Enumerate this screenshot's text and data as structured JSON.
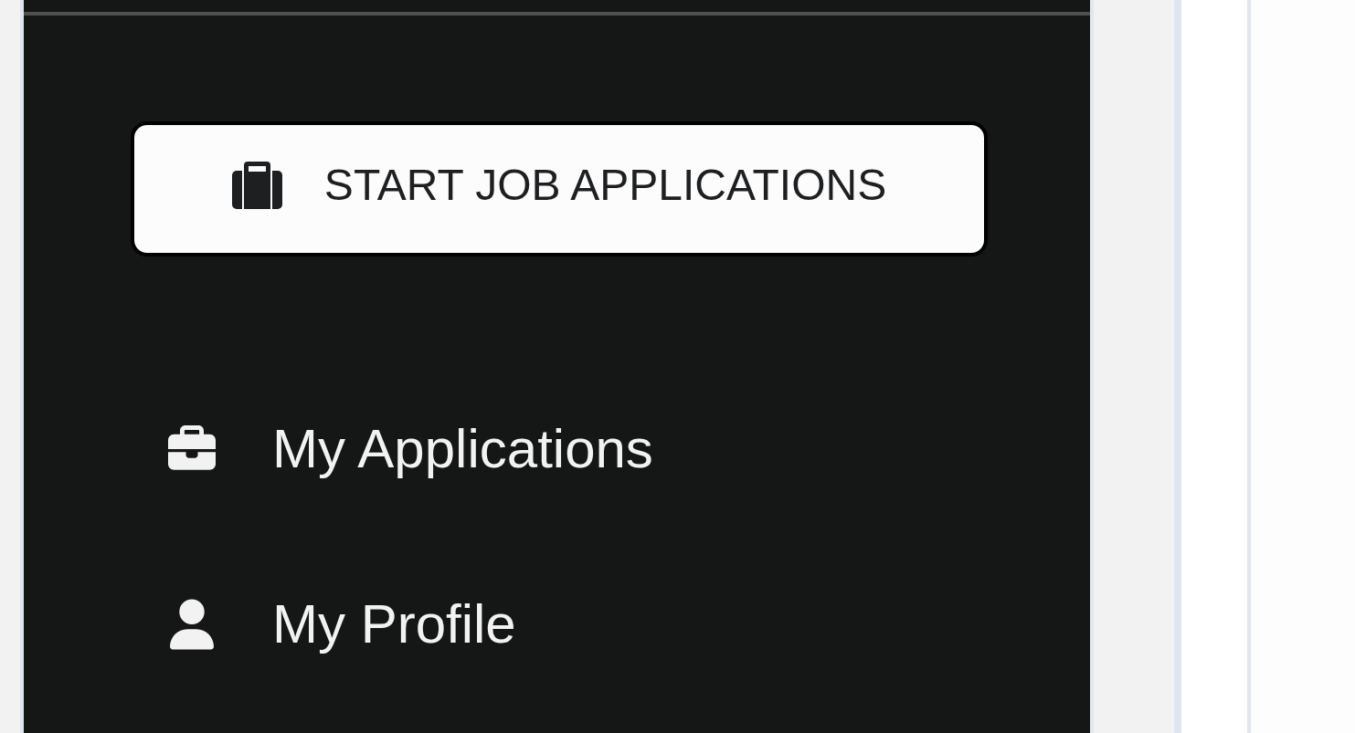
{
  "sidebar": {
    "primary_button": {
      "label": "START JOB APPLICATIONS"
    },
    "nav_items": [
      {
        "label": "My Applications"
      },
      {
        "label": "My Profile"
      }
    ]
  }
}
